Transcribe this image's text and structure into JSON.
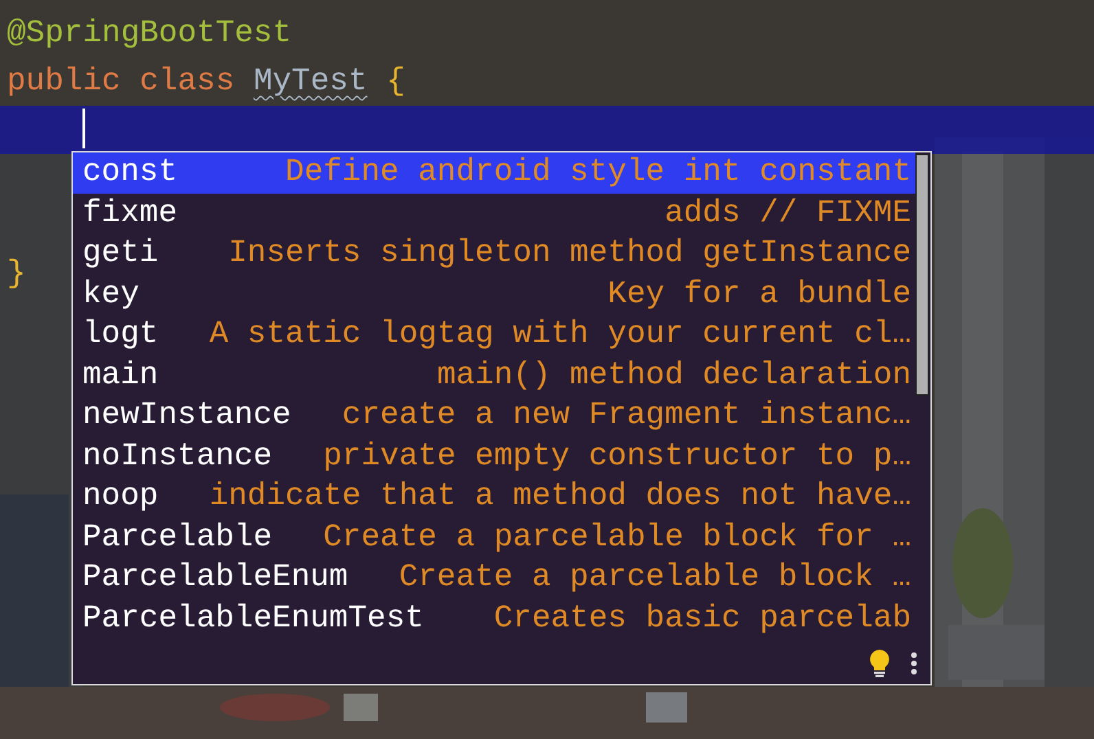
{
  "editor": {
    "lines": [
      {
        "current": false,
        "tokens": [
          {
            "kind": "annotation",
            "text": "@SpringBootTest",
            "warning": false
          }
        ]
      },
      {
        "current": false,
        "tokens": [
          {
            "kind": "keyword",
            "text": "public",
            "warning": false
          },
          {
            "kind": "keyword",
            "text": "class",
            "warning": false
          },
          {
            "kind": "class",
            "text": "MyTest",
            "warning": true
          },
          {
            "kind": "brace",
            "text": "{",
            "warning": false
          }
        ]
      },
      {
        "current": true,
        "caret": true
      },
      {
        "current": false
      },
      {
        "current": false
      },
      {
        "current": false,
        "tokens": [
          {
            "kind": "brace",
            "text": "}",
            "warning": false
          }
        ]
      }
    ]
  },
  "completion_popup": {
    "items": [
      {
        "name": "const",
        "description": "Define android style int constant",
        "selected": true
      },
      {
        "name": "fixme",
        "description": "adds // FIXME",
        "selected": false
      },
      {
        "name": "geti",
        "description": "Inserts singleton method getInstance",
        "selected": false
      },
      {
        "name": "key",
        "description": "Key for a bundle",
        "selected": false
      },
      {
        "name": "logt",
        "description": "A static logtag with your current cl…",
        "selected": false
      },
      {
        "name": "main",
        "description": "main() method declaration",
        "selected": false
      },
      {
        "name": "newInstance",
        "description": "create a new Fragment instanc…",
        "selected": false
      },
      {
        "name": "noInstance",
        "description": "private empty constructor to p…",
        "selected": false
      },
      {
        "name": "noop",
        "description": "indicate that a method does not have…",
        "selected": false
      },
      {
        "name": "Parcelable",
        "description": "Create a parcelable block for …",
        "selected": false
      },
      {
        "name": "ParcelableEnum",
        "description": "Create a parcelable block …",
        "selected": false
      },
      {
        "name": "ParcelableEnumTest",
        "description": "Creates basic parcelab",
        "selected": false
      }
    ]
  }
}
